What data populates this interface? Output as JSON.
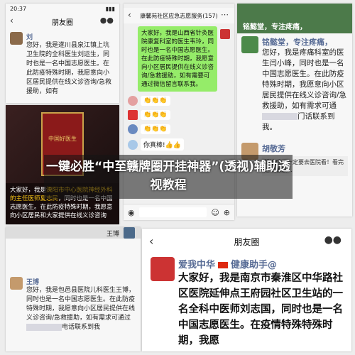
{
  "p1": {
    "time": "20:37",
    "title": "朋友圈",
    "name": "刘",
    "text": "您好，我是遂川县泉江镇上坑卫生院的全科医生刘运生，同时也是一名中国志愿医生。在此防疫特殊时期，我愿意向小区居民提供在线义诊咨询/急救援助，如有"
  },
  "p2": {
    "title": "康馨苑社区应急志愿服务(157)",
    "bubble": "大家好，我是山西省针灸医院康复科室的医生韦玲，同时也是一名中国志愿医生。在此防疫特殊时期，我愿意向小区居民提供在线义诊咨询/急救援助，如有需要可通过微信留言联系我。",
    "claps": [
      "👏👏👏",
      "👏👏👏",
      "👏👏👏"
    ],
    "cheer": "你真棒!👍👍"
  },
  "p3": {
    "topname": "铭懿堂，专注疼痛，",
    "name": "铭懿堂，专注疼痛，",
    "text1": "您好，我是疼痛科室的医生闫小峰，同时也是一名中国志愿医生。在此防疫特殊时期，我愿意向小区居民提供在线义诊咨询/急救援助，如有需求可通",
    "text2": "门话联系到我。",
    "name2": "胡敬芳",
    "text3": "阳性后不一定要去医院看！看完这本居家…"
  },
  "p4": {
    "book": "中国好医生",
    "speaker_prefix": "大家好，我是",
    "speaker_highlight": "溧阳市中心医院神经外科的主任医师夏志民",
    "text": "，同时也是一名中国志愿医生。在此防疫特殊时期，我愿意向小区居民和大家提供在线义诊咨询"
  },
  "p5": {
    "topname": "王博",
    "name": "王博",
    "text": "您好，我是包邑县医院儿科医生王博，同时也是一名中国志愿医生。在此防疫特殊时期，我愿意向小区居民提供在线义诊咨询/急救援助，如有需求可通过",
    "text2": "电话联系到我"
  },
  "p6": {
    "title": "朋友圈",
    "name": "爱我中华",
    "name_suffix": "健康助手@",
    "text": "大家好，我是南京市秦淮区中华路社区医院延伸点王府园社区卫生站的一名全科中医师刘志国，同时也是一名中国志愿医生。在疫情特殊特殊时期，我愿"
  },
  "overlay": {
    "title": "一键必胜“中至赣牌圈开挂神器”(透视)辅助透视教程"
  }
}
